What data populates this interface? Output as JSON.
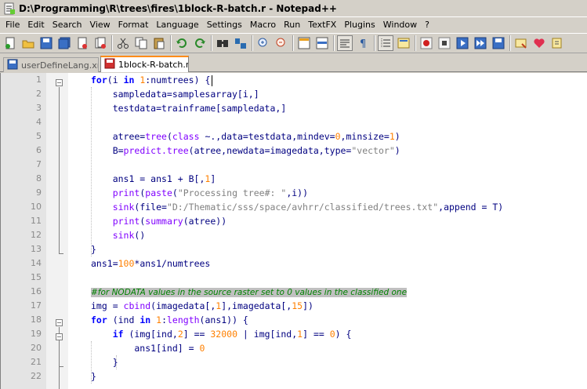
{
  "window": {
    "title": "D:\\Programming\\R\\trees\\fires\\1block-R-batch.r - Notepad++"
  },
  "menu": [
    "File",
    "Edit",
    "Search",
    "View",
    "Format",
    "Language",
    "Settings",
    "Macro",
    "Run",
    "TextFX",
    "Plugins",
    "Window",
    "?"
  ],
  "toolbar": {
    "buttons": [
      "new-icon",
      "open-icon",
      "save-icon",
      "save-all-icon",
      "close-icon",
      "close-all-icon",
      "cut-icon",
      "copy-icon",
      "paste-icon",
      "undo-icon",
      "redo-icon",
      "find-icon",
      "replace-icon",
      "zoom-in-icon",
      "zoom-out-icon",
      "sync-vertical-icon",
      "sync-horizontal-icon",
      "word-wrap-icon",
      "show-all-chars-icon",
      "indent-guide-icon",
      "user-lang-icon",
      "record-macro-icon",
      "stop-record-icon",
      "play-macro-icon",
      "play-multiple-icon",
      "save-macro-icon",
      "plugin-icon",
      "heart-icon",
      "close-doc-icon"
    ]
  },
  "tabs": [
    {
      "label": "userDefineLang.xml",
      "active": false
    },
    {
      "label": "1block-R-batch.r",
      "active": true
    }
  ],
  "editor": {
    "lines": [
      {
        "n": "1",
        "text": "for(i in 1:numtrees) {"
      },
      {
        "n": "2",
        "text": "    sampledata=samplesarray[i,]"
      },
      {
        "n": "3",
        "text": "    testdata=trainframe[sampledata,]"
      },
      {
        "n": "4",
        "text": ""
      },
      {
        "n": "5",
        "text": "    atree=tree(class ~.,data=testdata,mindev=0,minsize=1)"
      },
      {
        "n": "6",
        "text": "    B=predict.tree(atree,newdata=imagedata,type=\"vector\")"
      },
      {
        "n": "7",
        "text": ""
      },
      {
        "n": "8",
        "text": "    ans1 = ans1 + B[,1]"
      },
      {
        "n": "9",
        "text": "    print(paste(\"Processing tree#: \",i))"
      },
      {
        "n": "10",
        "text": "    sink(file=\"D:/Thematic/sss/space/avhrr/classified/trees.txt\",append = T)"
      },
      {
        "n": "11",
        "text": "    print(summary(atree))"
      },
      {
        "n": "12",
        "text": "    sink()"
      },
      {
        "n": "13",
        "text": "}"
      },
      {
        "n": "14",
        "text": "ans1=100*ans1/numtrees"
      },
      {
        "n": "15",
        "text": ""
      },
      {
        "n": "16",
        "text": "#for NODATA values in the source raster set to 0 values in the classified one"
      },
      {
        "n": "17",
        "text": "img = cbind(imagedata[,1],imagedata[,15])"
      },
      {
        "n": "18",
        "text": "for (ind in 1:length(ans1)) {"
      },
      {
        "n": "19",
        "text": "    if (img[ind,2] == 32000 | img[ind,1] == 0) {"
      },
      {
        "n": "20",
        "text": "        ans1[ind] = 0"
      },
      {
        "n": "21",
        "text": "    }"
      },
      {
        "n": "22",
        "text": "}"
      }
    ]
  },
  "colors": {
    "keyword": "#0000ff",
    "number": "#ff8000",
    "string": "#808080",
    "function": "#8000ff",
    "comment": "#008000",
    "default": "#000080",
    "active_tab_accent": "#ff8c1a"
  }
}
